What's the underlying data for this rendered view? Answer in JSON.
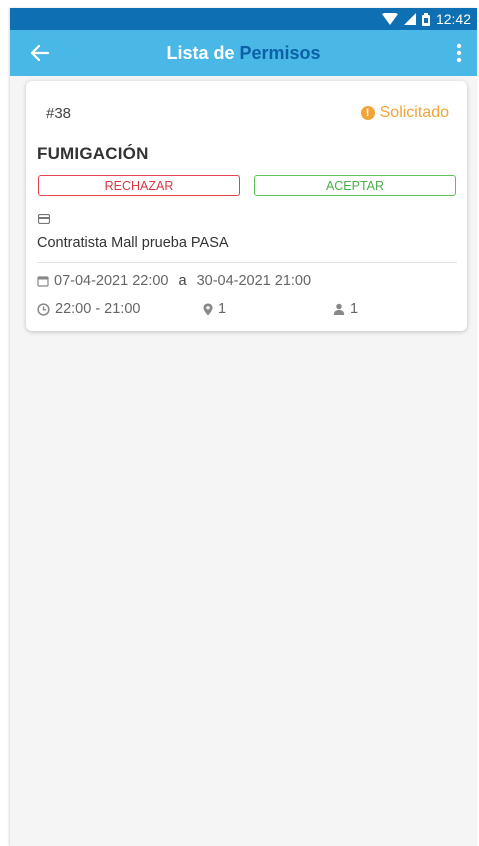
{
  "status_bar": {
    "time": "12:42",
    "icons": [
      "wifi-icon",
      "signal-icon",
      "battery-icon"
    ]
  },
  "toolbar": {
    "title_part1": "Lista de ",
    "title_part2": "Permisos",
    "back_icon": "arrow-left-icon",
    "menu_icon": "more-vertical-icon"
  },
  "permit": {
    "number": "#38",
    "status": "Solicitado",
    "status_color": "#f0a43a",
    "type": "FUMIGACIÓN",
    "reject_label": "RECHAZAR",
    "accept_label": "ACEPTAR",
    "entity_icon": "building-icon",
    "contractor": "Contratista Mall prueba PASA",
    "date_from": "07-04-2021 22:00",
    "date_separator": "a",
    "date_to": "30-04-2021 21:00",
    "hours": "22:00 - 21:00",
    "locations": "1",
    "persons": "1"
  },
  "colors": {
    "status_bar": "#0f6fb3",
    "toolbar": "#49b8e6",
    "title_accent": "#0c60a8",
    "reject": "#e5424f",
    "accept": "#5cc15c"
  }
}
